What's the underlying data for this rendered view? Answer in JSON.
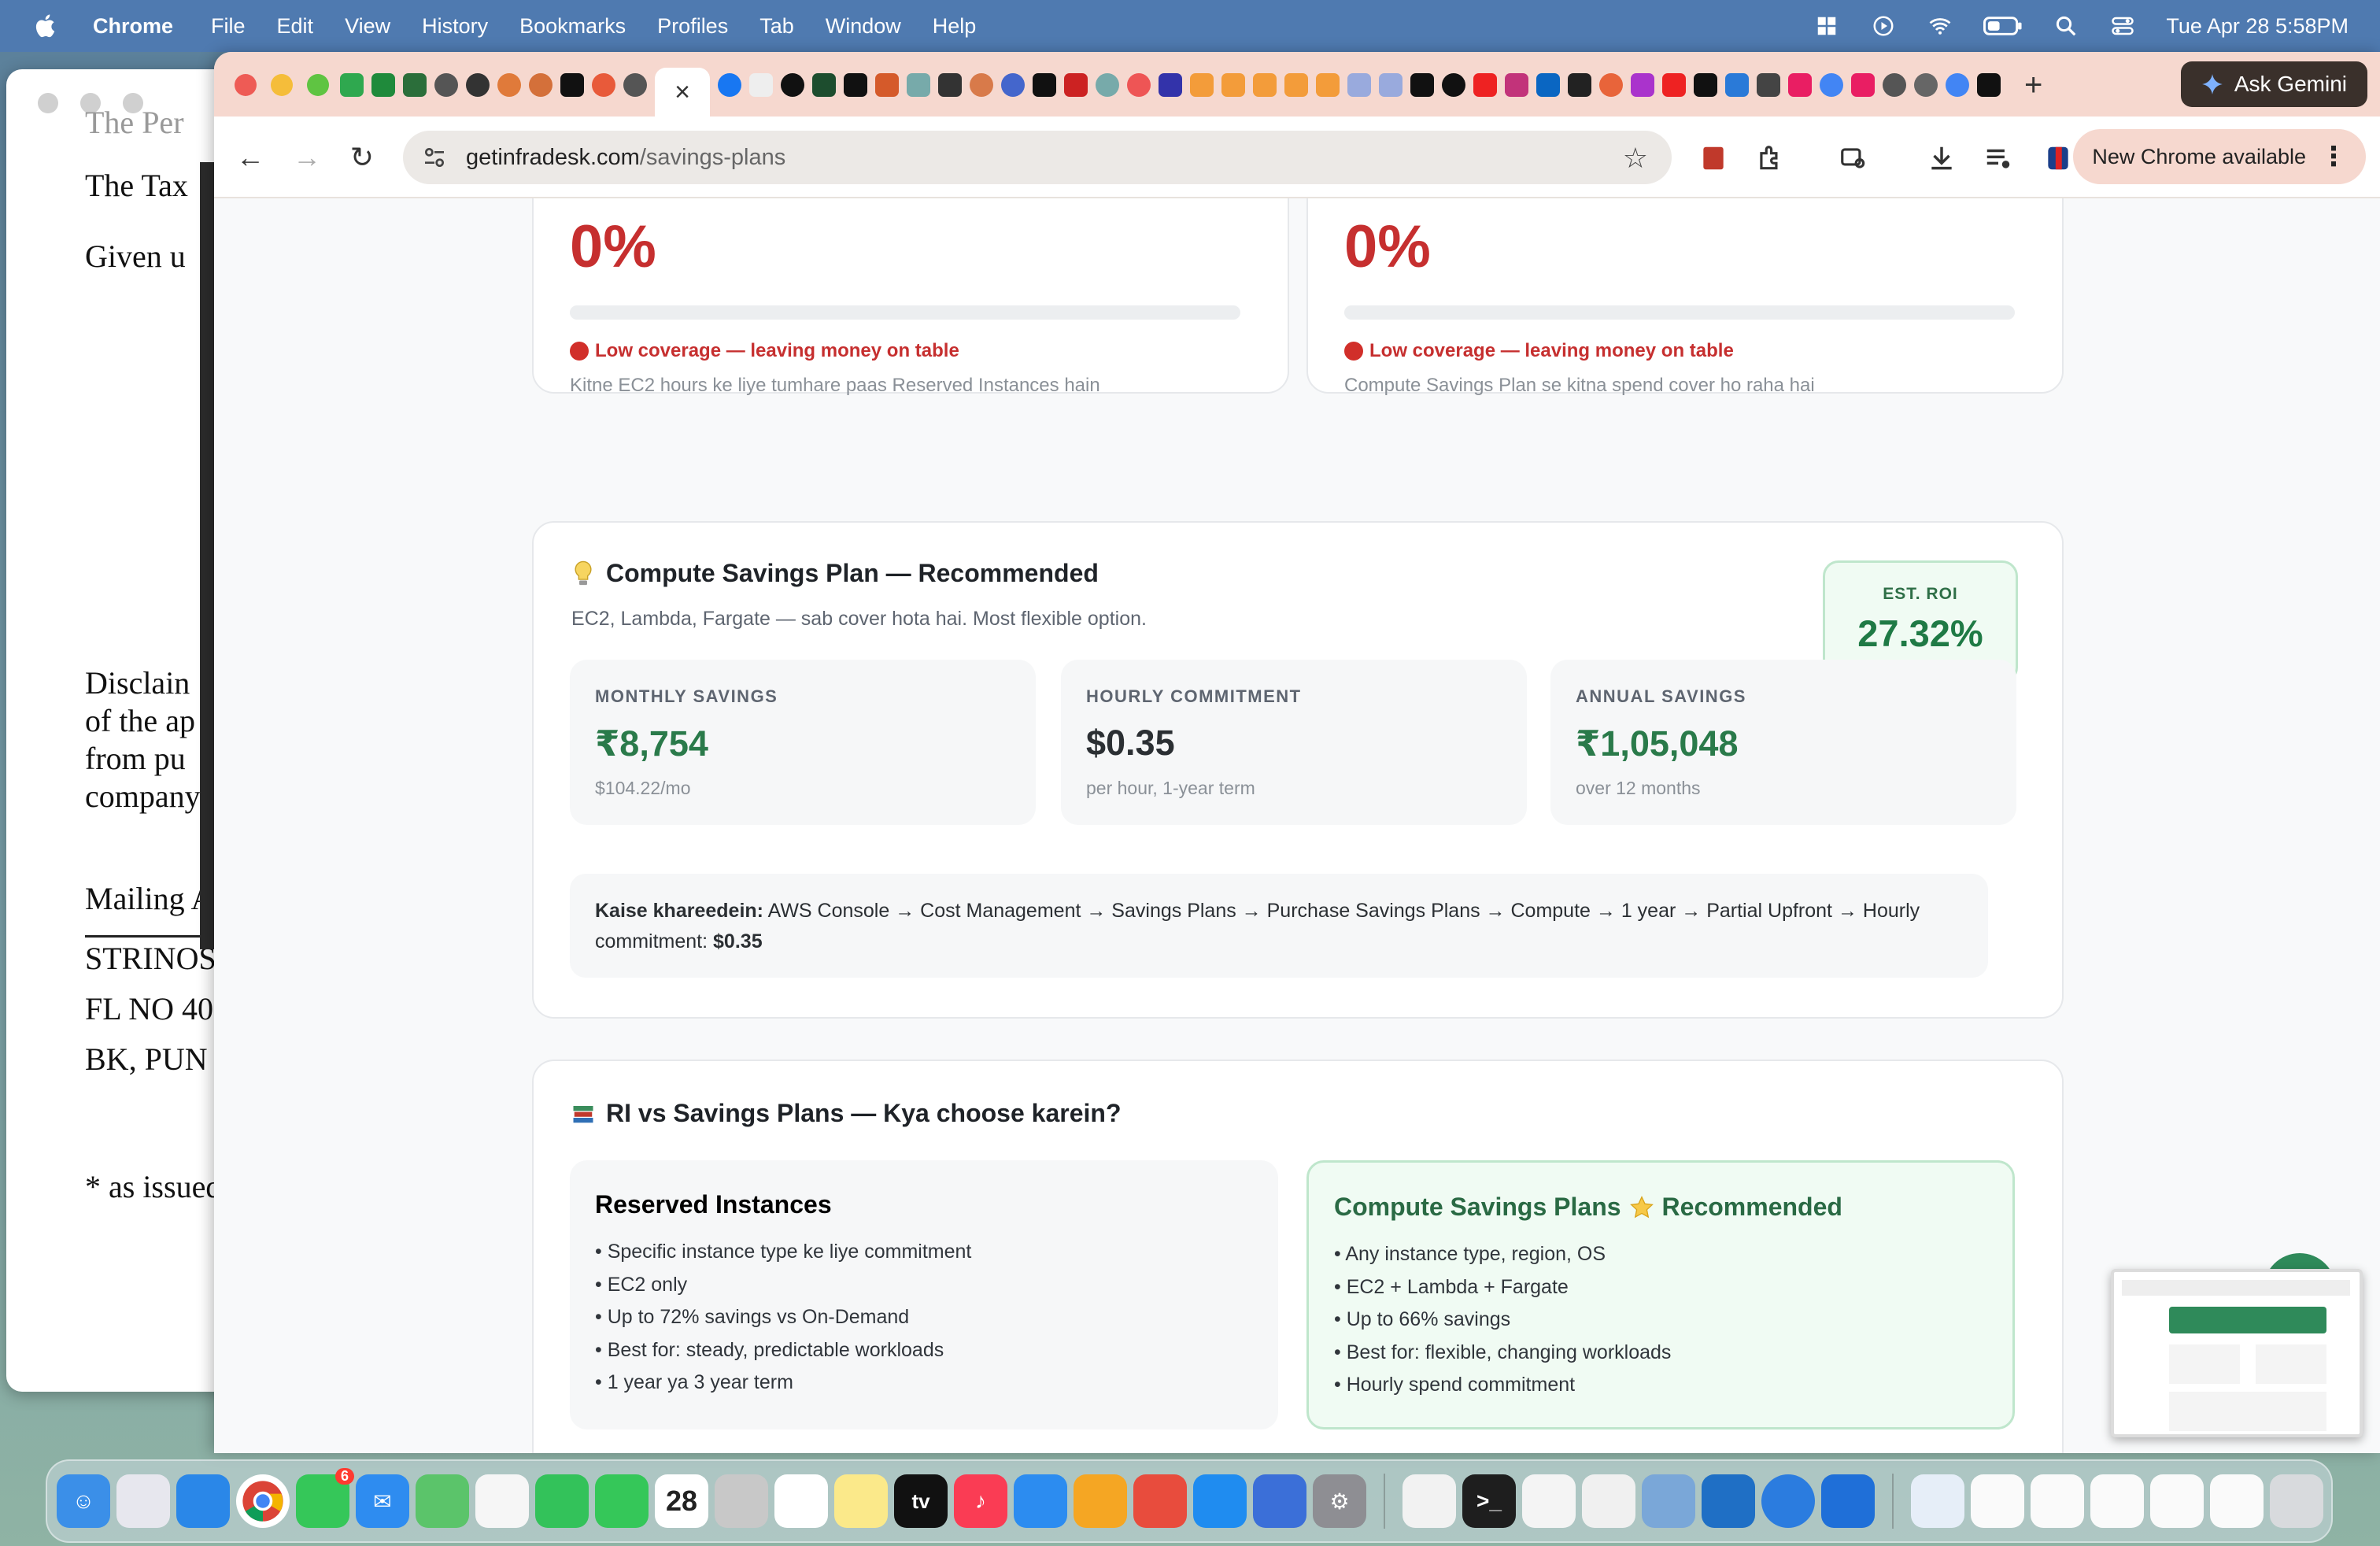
{
  "menubar": {
    "app_name": "Chrome",
    "menus": [
      "File",
      "Edit",
      "View",
      "History",
      "Bookmarks",
      "Profiles",
      "Tab",
      "Window",
      "Help"
    ],
    "datetime": "Tue Apr 28  5:58PM"
  },
  "background_doc": {
    "lines": [
      "The Per",
      "The Tax",
      "Given u",
      "Disclain",
      "of the ap",
      "from pu",
      "company",
      "Mailing A",
      "STRINOS",
      "FL NO 40",
      "BK, PUN",
      "* as issued"
    ]
  },
  "browser": {
    "gemini_label": "Ask Gemini",
    "url_domain": "getinfradesk.com",
    "url_path": "/savings-plans",
    "update_label": "New Chrome available",
    "active_tab_close": "×",
    "new_tab": "+"
  },
  "coverage": {
    "left": {
      "percent": "0%",
      "fill_fraction": 0,
      "warning": "Low coverage — leaving money on table",
      "description": "Kitne EC2 hours ke liye tumhare paas Reserved Instances hain"
    },
    "right": {
      "percent": "0%",
      "fill_fraction": 0,
      "warning": "Low coverage — leaving money on table",
      "description": "Compute Savings Plan se kitna spend cover ho raha hai"
    }
  },
  "recommendation": {
    "title": "Compute Savings Plan — Recommended",
    "description": "EC2, Lambda, Fargate — sab cover hota hai. Most flexible option.",
    "roi_label": "EST. ROI",
    "roi_value": "27.32%",
    "stats": [
      {
        "label": "MONTHLY SAVINGS",
        "value": "₹8,754",
        "sub": "$104.22/mo"
      },
      {
        "label": "HOURLY COMMITMENT",
        "value": "$0.35",
        "sub": "per hour, 1-year term"
      },
      {
        "label": "ANNUAL SAVINGS",
        "value": "₹1,05,048",
        "sub": "over 12 months"
      }
    ],
    "how_label": "Kaise khareedein:",
    "how_text": " AWS Console → Cost Management → Savings Plans → Purchase Savings Plans → Compute → 1 year → Partial Upfront → Hourly commitment: ",
    "how_value": "$0.35"
  },
  "comparison": {
    "title": "RI vs Savings Plans — Kya choose karein?",
    "reserved": {
      "title": "Reserved Instances",
      "points": [
        "• Specific instance type ke liye commitment",
        "• EC2 only",
        "• Up to 72% savings vs On-Demand",
        "• Best for: steady, predictable workloads",
        "• 1 year ya 3 year term"
      ]
    },
    "savings_plans": {
      "title": "Compute Savings Plans",
      "badge": "Recommended",
      "points": [
        "• Any instance type, region, OS",
        "• EC2 + Lambda + Fargate",
        "• Up to 66% savings",
        "• Best for: flexible, changing workloads",
        "• Hourly spend commitment"
      ]
    }
  },
  "dock": {
    "calendar_day": "28",
    "tv_label": "tv",
    "messages_badge": "6"
  },
  "colors": {
    "danger": "#c62f2f",
    "success": "#1f7a45",
    "tab_strip": "#f6d8cf"
  }
}
